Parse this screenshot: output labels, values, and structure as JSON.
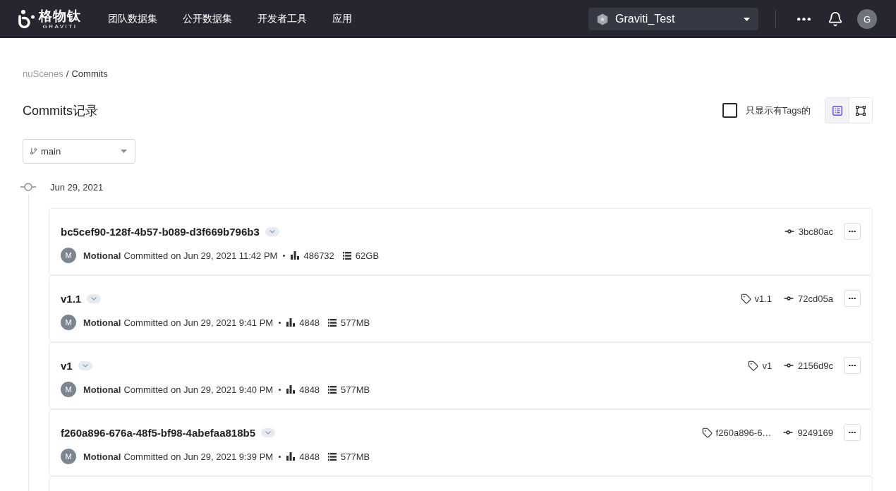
{
  "header": {
    "logo": {
      "name": "格物钛",
      "subtitle": "GRAVITI"
    },
    "nav": [
      {
        "label": "团队数据集",
        "selected": false
      },
      {
        "label": "公开数据集",
        "selected": false
      },
      {
        "label": "开发者工具",
        "selected": false
      },
      {
        "label": "应用",
        "selected": false
      }
    ],
    "workspace": "Graviti_Test",
    "user_initial": "G"
  },
  "breadcrumb": {
    "items": [
      "nuScenes",
      "Commits"
    ],
    "separator": "/"
  },
  "page_title": "Commits记录",
  "tag_filter": {
    "label": "只显示有Tags的",
    "checked": false
  },
  "view_toggle": [
    {
      "kind": "list",
      "selected": true
    },
    {
      "kind": "graph",
      "selected": false
    }
  ],
  "branch": {
    "value": "main"
  },
  "date_group": {
    "date": "Jun 29, 2021"
  },
  "commits": [
    {
      "title": "bc5cef90-128f-4b57-b089-d3f669b796b3",
      "hash": "3bc80ac",
      "author": "Motional",
      "author_initial": "M",
      "time": "Committed on Jun 29, 2021 11:42 PM",
      "count": "486732",
      "size": "62GB"
    },
    {
      "title": "v1.1",
      "tag": "v1.1",
      "hash": "72cd05a",
      "author": "Motional",
      "author_initial": "M",
      "time": "Committed on Jun 29, 2021 9:41 PM",
      "count": "4848",
      "size": "577MB"
    },
    {
      "title": "v1",
      "tag": "v1",
      "hash": "2156d9c",
      "author": "Motional",
      "author_initial": "M",
      "time": "Committed on Jun 29, 2021 9:40 PM",
      "count": "4848",
      "size": "577MB"
    },
    {
      "title": "f260a896-676a-48f5-bf98-4abefaa818b5",
      "tag": "f260a896-6…",
      "hash": "9249169",
      "author": "Motional",
      "author_initial": "M",
      "time": "Committed on Jun 29, 2021 9:39 PM",
      "count": "4848",
      "size": "577MB"
    }
  ],
  "more_below": true
}
